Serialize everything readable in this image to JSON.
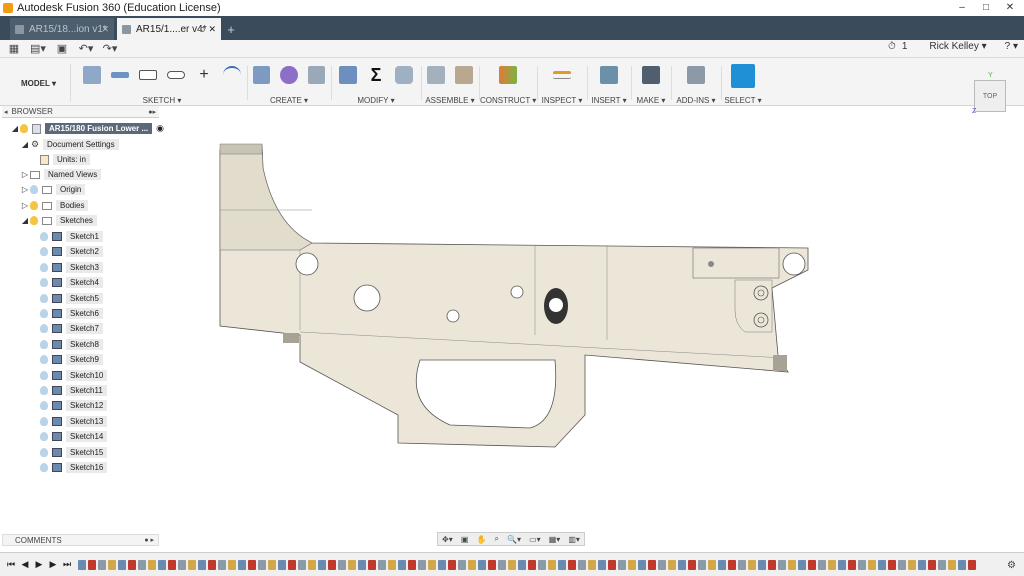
{
  "window": {
    "title": "Autodesk Fusion 360 (Education License)",
    "minimize": "–",
    "maximize": "□",
    "close": "✕"
  },
  "tabs": [
    {
      "label": "AR15/18...ion v1*",
      "active": false
    },
    {
      "label": "AR15/1....er v4*",
      "active": true
    }
  ],
  "tab_add": "+",
  "quickbar": {
    "jobs_count": "1",
    "user": "Rick Kelley ▾",
    "help": "? ▾"
  },
  "ribbon": {
    "workspace": "MODEL ▾",
    "groups": [
      {
        "label": "SKETCH ▾"
      },
      {
        "label": "CREATE ▾"
      },
      {
        "label": "MODIFY ▾"
      },
      {
        "label": "ASSEMBLE ▾"
      },
      {
        "label": "CONSTRUCT ▾"
      },
      {
        "label": "INSPECT ▾"
      },
      {
        "label": "INSERT ▾"
      },
      {
        "label": "MAKE ▾"
      },
      {
        "label": "ADD-INS ▾"
      },
      {
        "label": "SELECT ▾"
      }
    ]
  },
  "browser": {
    "header": "BROWSER",
    "root": "AR15/180 Fusion Lower ...",
    "document_settings": "Document Settings",
    "units": "Units: in",
    "named_views": "Named Views",
    "origin": "Origin",
    "bodies": "Bodies",
    "sketches": "Sketches",
    "sketch_items": [
      "Sketch1",
      "Sketch2",
      "Sketch3",
      "Sketch4",
      "Sketch5",
      "Sketch6",
      "Sketch7",
      "Sketch8",
      "Sketch9",
      "Sketch10",
      "Sketch11",
      "Sketch12",
      "Sketch13",
      "Sketch14",
      "Sketch15",
      "Sketch16"
    ]
  },
  "viewcube": {
    "face": "TOP",
    "y": "Y",
    "z": "Z"
  },
  "comments": {
    "label": "COMMENTS"
  },
  "colors": {
    "body_fill": "#ece6d8",
    "body_stroke": "#555555",
    "select_accent": "#1f8fd6",
    "tabbar_bg": "#3a4b5c"
  }
}
